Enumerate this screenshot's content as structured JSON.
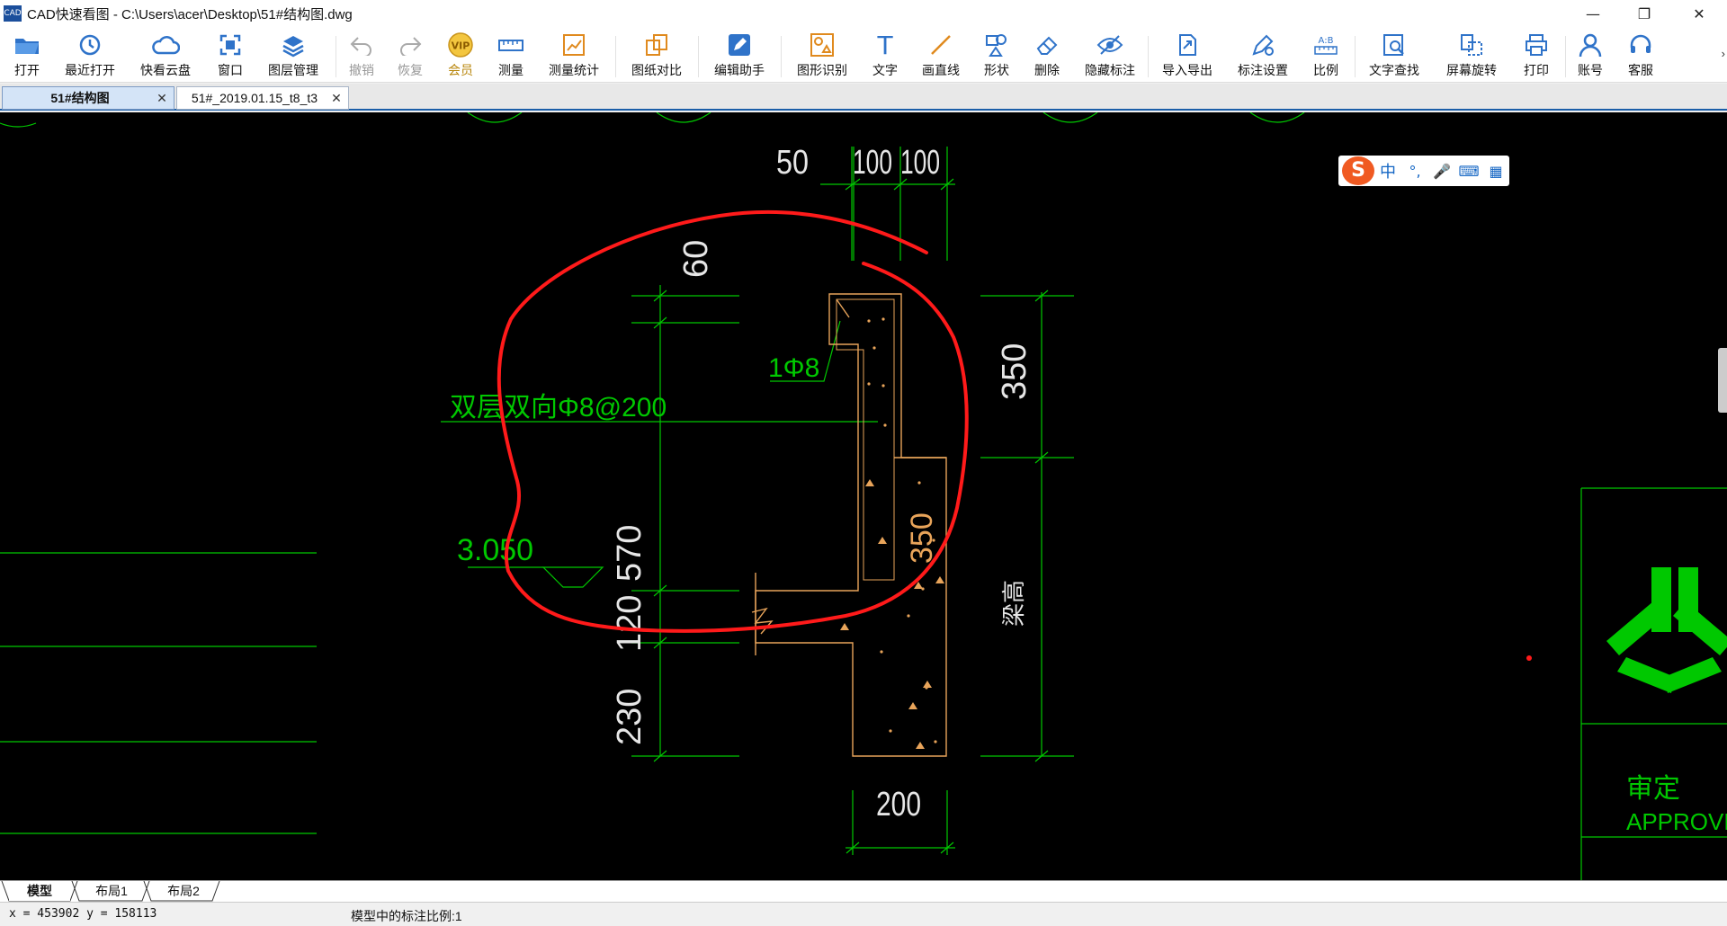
{
  "window": {
    "app_icon": "CAD",
    "title": "CAD快速看图 - C:\\Users\\acer\\Desktop\\51#结构图.dwg",
    "minimize": "—",
    "restore": "❐",
    "close": "✕"
  },
  "toolbar": {
    "items": [
      {
        "label": "打开",
        "icon": "folder-open-icon"
      },
      {
        "label": "最近打开",
        "icon": "history-icon"
      },
      {
        "label": "快看云盘",
        "icon": "cloud-icon"
      },
      {
        "label": "窗口",
        "icon": "window-icon"
      },
      {
        "label": "图层管理",
        "icon": "layers-icon"
      },
      {
        "label": "撤销",
        "icon": "undo-icon"
      },
      {
        "label": "恢复",
        "icon": "redo-icon"
      },
      {
        "label": "会员",
        "icon": "vip-icon"
      },
      {
        "label": "测量",
        "icon": "ruler-icon"
      },
      {
        "label": "测量统计",
        "icon": "measure-stats-icon"
      },
      {
        "label": "图纸对比",
        "icon": "compare-icon"
      },
      {
        "label": "编辑助手",
        "icon": "edit-assistant-icon"
      },
      {
        "label": "图形识别",
        "icon": "shape-recognize-icon"
      },
      {
        "label": "文字",
        "icon": "text-icon"
      },
      {
        "label": "画直线",
        "icon": "line-icon"
      },
      {
        "label": "形状",
        "icon": "shape-icon"
      },
      {
        "label": "删除",
        "icon": "eraser-icon"
      },
      {
        "label": "隐藏标注",
        "icon": "eye-hide-icon"
      },
      {
        "label": "导入导出",
        "icon": "import-export-icon"
      },
      {
        "label": "标注设置",
        "icon": "annotation-settings-icon"
      },
      {
        "label": "比例",
        "icon": "scale-icon"
      },
      {
        "label": "文字查找",
        "icon": "text-search-icon"
      },
      {
        "label": "屏幕旋转",
        "icon": "rotate-screen-icon"
      },
      {
        "label": "打印",
        "icon": "printer-icon"
      },
      {
        "label": "账号",
        "icon": "user-icon"
      },
      {
        "label": "客服",
        "icon": "headset-icon"
      }
    ],
    "vip_badge": "VIP",
    "ab_badge": "A:B",
    "text_glyph": "T",
    "more": "›"
  },
  "tabs": [
    {
      "label": "51#结构图",
      "close": "✕"
    },
    {
      "label": "51#_2019.01.15_t8_t3",
      "close": "✕"
    }
  ],
  "drawing": {
    "dims_top": [
      "50",
      "100",
      "100"
    ],
    "dim_60": "60",
    "rebar_1": "1Φ8",
    "rebar_note": "双层双向Φ8@200",
    "dim_570": "570",
    "elev": "3.050",
    "dim_120": "120",
    "dim_230": "230",
    "dim_350_right": "350",
    "dim_350_inner": "350",
    "beam_height": "梁高",
    "dim_200": "200",
    "title_block_text": "审定",
    "title_block_en": "APPROVED"
  },
  "ime": {
    "logo": "S",
    "lang": "中",
    "punct": "°,",
    "mic": "🎤",
    "keyboard": "⌨",
    "tools": "▦"
  },
  "colors": {
    "cad_green": "#00c800",
    "cad_orange": "#e8a45a",
    "markup_red": "#ff1a1a",
    "accent_blue": "#1b5ea8"
  },
  "layout_tabs": [
    "模型",
    "布局1",
    "布局2"
  ],
  "status": {
    "coords": "x = 453902  y = 158113",
    "scale": "模型中的标注比例:1"
  }
}
